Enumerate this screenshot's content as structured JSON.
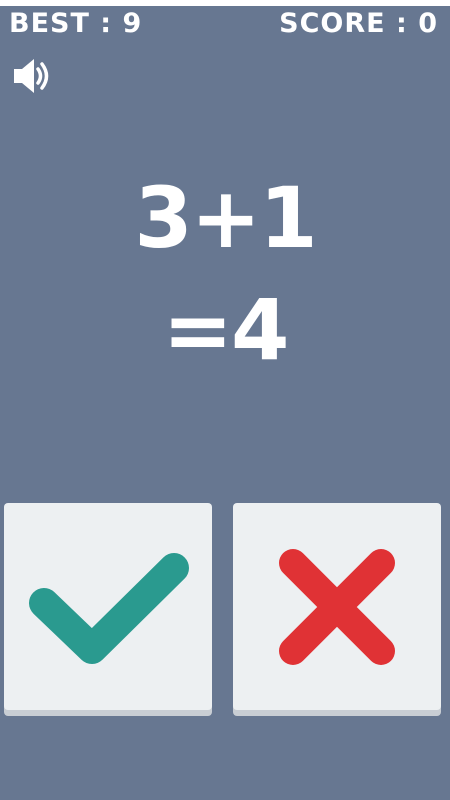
{
  "hud": {
    "best_text": "BEST : 9",
    "score_text": "SCORE : 0"
  },
  "equation": {
    "expression": "3+1",
    "result": "=4"
  },
  "buttons": {
    "correct_icon": "checkmark-icon",
    "wrong_icon": "cross-icon"
  },
  "colors": {
    "background": "#677791",
    "check": "#2a9a8f",
    "cross": "#e03235",
    "button": "#edf0f2"
  },
  "icons": {
    "sound": "speaker-icon"
  }
}
